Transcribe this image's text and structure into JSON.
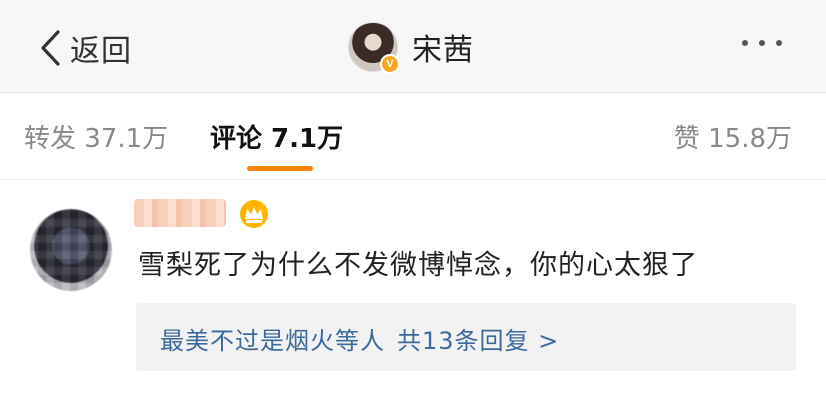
{
  "nav": {
    "back_label": "返回",
    "title": "宋茜",
    "badge": "V"
  },
  "tabs": {
    "repost": "转发 37.1万",
    "comment": "评论 7.1万",
    "like": "赞 15.8万",
    "active_color": "#ff8200"
  },
  "comment": {
    "text": "雪梨死了为什么不发微博悼念，你的心太狠了",
    "reply_preview": "最美不过是烟火等人",
    "reply_count": "共13条回复 >"
  }
}
